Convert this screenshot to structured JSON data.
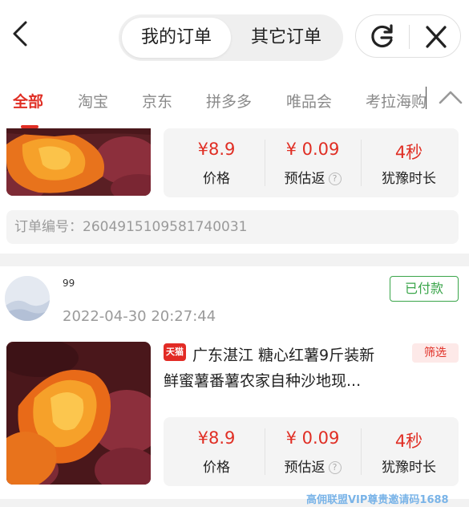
{
  "header": {
    "active_tab": "我的订单",
    "other_tab": "其它订单"
  },
  "tabs": [
    "全部",
    "淘宝",
    "京东",
    "拼多多",
    "唯品会",
    "考拉海购"
  ],
  "orders": [
    {
      "price": "¥8.9",
      "price_label": "价格",
      "rebate": "¥ 0.09",
      "rebate_label": "预估返",
      "hesitation": "4秒",
      "hesitation_label": "犹豫时长",
      "order_number": "订单编号：2604915109581740031"
    },
    {
      "username": "99",
      "time": "2022-04-30 20:27:44",
      "status": "已付款",
      "shop_badge": "天猫",
      "title_line1": "广东湛江 糖心红薯9斤装新",
      "title_line2": "鲜蜜薯番薯农家自种沙地现...",
      "filter_tag": "筛选",
      "price": "¥8.9",
      "price_label": "价格",
      "rebate": "¥ 0.09",
      "rebate_label": "预估返",
      "hesitation": "4秒",
      "hesitation_label": "犹豫时长"
    }
  ],
  "watermark": "高佣联盟VIP尊贵邀请码1688",
  "colors": {
    "accent": "#e02e24",
    "paid": "#3aa54a"
  }
}
